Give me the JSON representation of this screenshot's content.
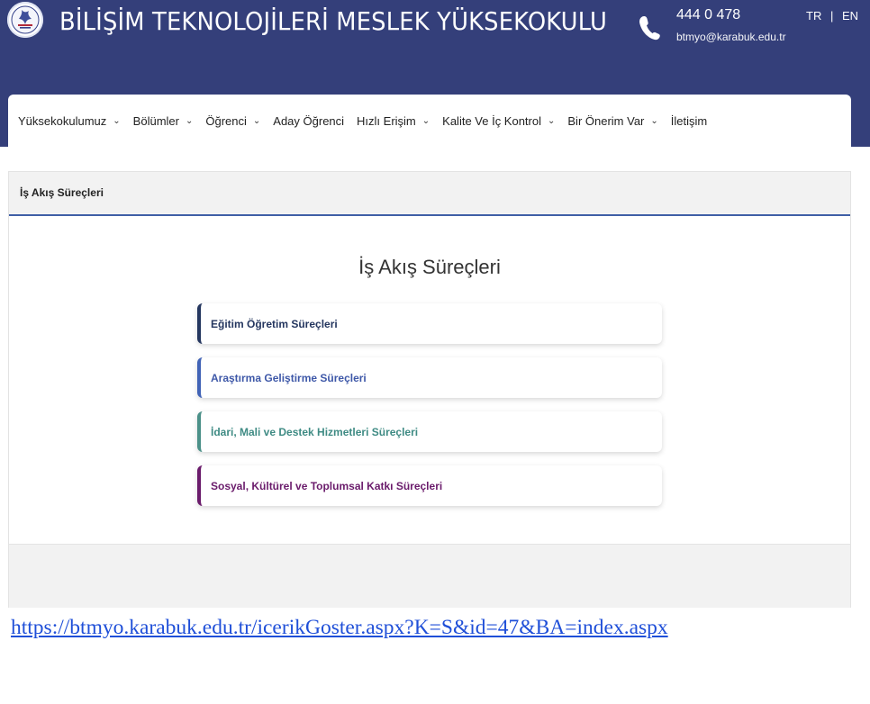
{
  "header": {
    "title": "BİLİŞİM TEKNOLOJİLERİ MESLEK YÜKSEKOKULU",
    "phone": "444 0 478",
    "email": "btmyo@karabuk.edu.tr",
    "lang_tr": "TR",
    "lang_sep": "|",
    "lang_en": "EN",
    "background_color": "#343f7a",
    "phone_icon": "phone-icon",
    "logo_icon": "university-logo"
  },
  "nav": {
    "items": [
      {
        "label": "Yüksekokulumuz",
        "chevron": "⌄"
      },
      {
        "label": "Bölümler",
        "chevron": "⌄"
      },
      {
        "label": "Öğrenci",
        "chevron": "⌄"
      },
      {
        "label": "Aday Öğrenci",
        "chevron": ""
      },
      {
        "label": "Hızlı Erişim",
        "chevron": "⌄"
      },
      {
        "label": "Kalite Ve İç Kontrol",
        "chevron": "⌄"
      },
      {
        "label": "Bir Önerim Var",
        "chevron": "⌄"
      },
      {
        "label": "İletişim",
        "chevron": ""
      }
    ]
  },
  "card": {
    "header_title": "İş Akış Süreçleri",
    "section_title": "İş Akış Süreçleri",
    "accent_color": "#3f5fa6",
    "items": [
      {
        "label": "Eğitim Öğretim Süreçleri",
        "color": "#24365f"
      },
      {
        "label": "Araştırma Geliştirme Süreçleri",
        "color": "#3e58a8"
      },
      {
        "label": "İdari, Mali ve Destek Hizmetleri Süreçleri",
        "color": "#3f8b84"
      },
      {
        "label": "Sosyal, Kültürel ve Toplumsal Katkı Süreçleri",
        "color": "#6a1b6b"
      }
    ]
  },
  "url": {
    "text": "https://btmyo.karabuk.edu.tr/icerikGoster.aspx?K=S&id=47&BA=index.aspx",
    "color": "#1f4fd8"
  }
}
